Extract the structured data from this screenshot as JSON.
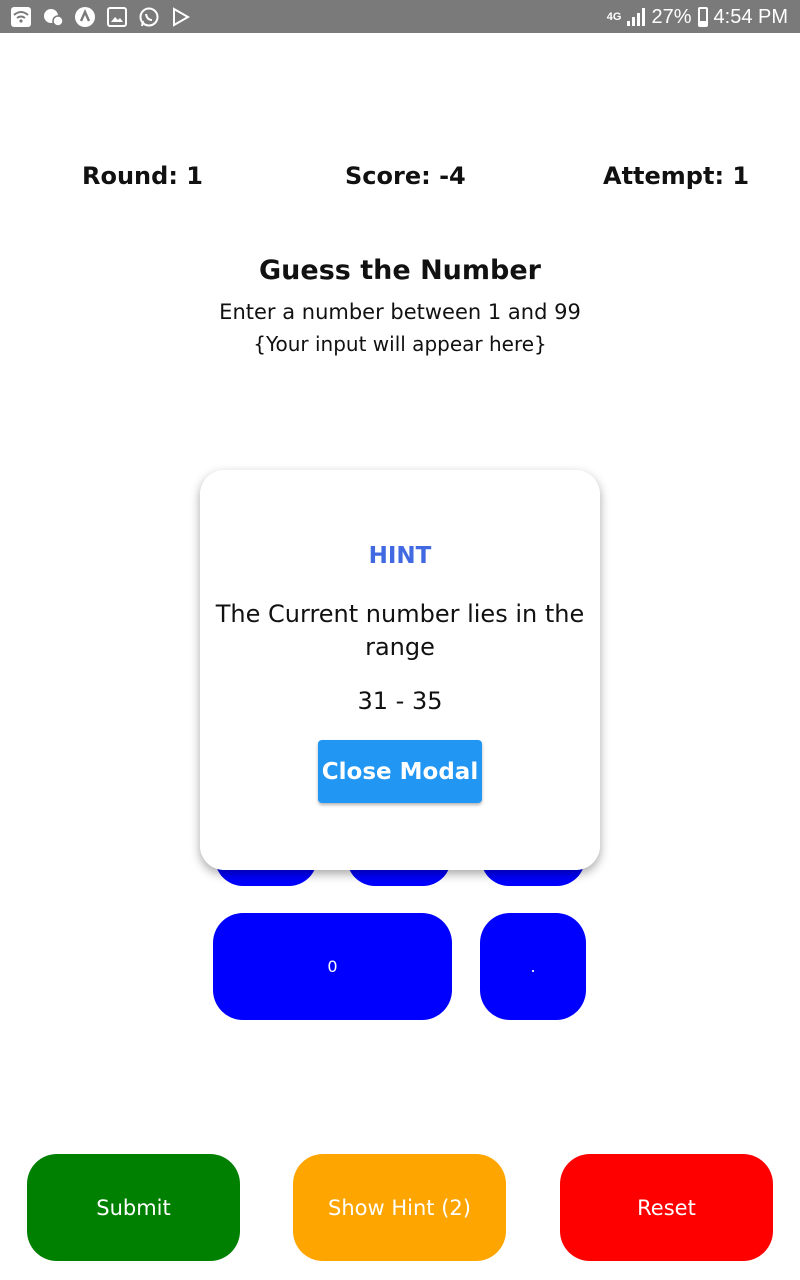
{
  "status_bar": {
    "network": "4G",
    "battery": "27%",
    "time": "4:54 PM",
    "icons": [
      "wifi-icon",
      "notification-icon",
      "app-icon",
      "image-icon",
      "whatsapp-icon",
      "play-store-icon"
    ]
  },
  "stats": {
    "round_label": "Round: 1",
    "score_label": "Score: -4",
    "attempt_label": "Attempt: 1"
  },
  "game": {
    "title": "Guess the Number",
    "instruction": "Enter a number between 1 and 99",
    "input_placeholder": "{Your input will appear here}"
  },
  "keypad": {
    "zero_label": "0",
    "dot_label": "."
  },
  "modal": {
    "title": "HINT",
    "text": "The Current number lies in the range",
    "range": "31 - 35",
    "close_label": "Close Modal"
  },
  "actions": {
    "submit_label": "Submit",
    "hint_label": "Show Hint (2)",
    "reset_label": "Reset"
  },
  "colors": {
    "keypad": "#0000ff",
    "submit": "#008000",
    "hint": "#ffa500",
    "reset": "#ff0000",
    "modal_title": "#4169e1",
    "close_button": "#2196f3"
  }
}
